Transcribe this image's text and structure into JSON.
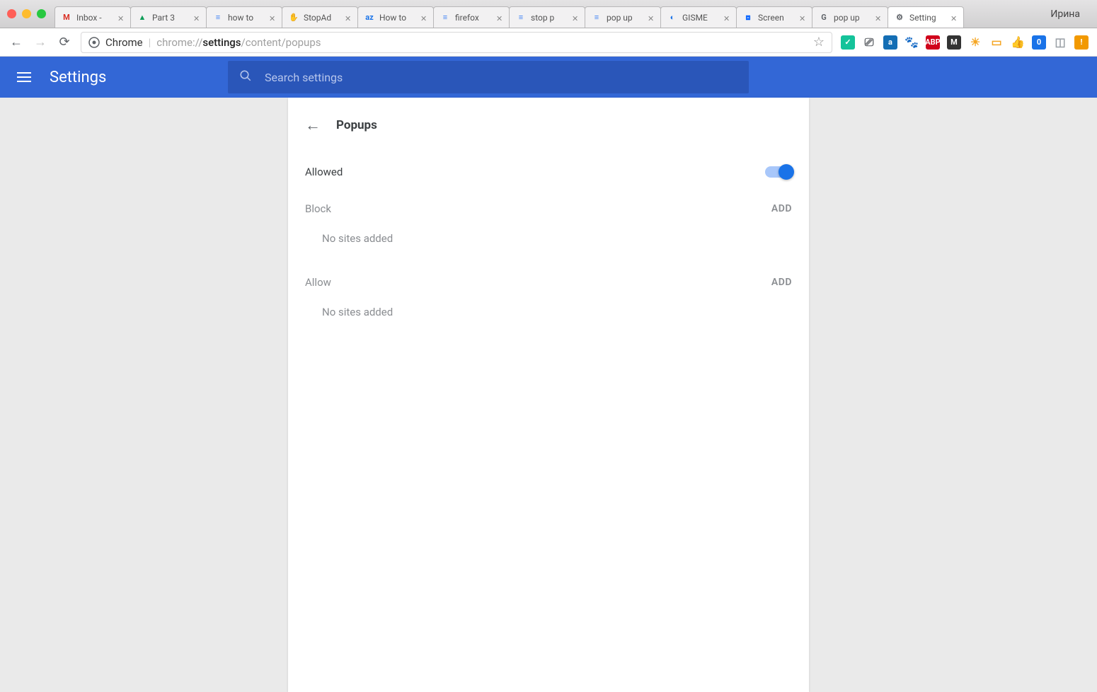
{
  "window": {
    "user": "Ирина"
  },
  "tabs": [
    {
      "label": "Inbox -",
      "favicon_text": "M",
      "favicon_color": "#d93025"
    },
    {
      "label": "Part 3",
      "favicon_text": "▲",
      "favicon_color": "#0f9d58"
    },
    {
      "label": "how to",
      "favicon_text": "≡",
      "favicon_color": "#4285f4"
    },
    {
      "label": "StopAd",
      "favicon_text": "✋",
      "favicon_color": "#e8710a"
    },
    {
      "label": "How to",
      "favicon_text": "az",
      "favicon_color": "#1a73e8"
    },
    {
      "label": "firefox",
      "favicon_text": "≡",
      "favicon_color": "#4285f4"
    },
    {
      "label": "stop p",
      "favicon_text": "≡",
      "favicon_color": "#4285f4"
    },
    {
      "label": "pop up",
      "favicon_text": "≡",
      "favicon_color": "#4285f4"
    },
    {
      "label": "GISME",
      "favicon_text": "◐",
      "favicon_color": "#1a73e8"
    },
    {
      "label": "Screen",
      "favicon_text": "⧈",
      "favicon_color": "#0061ff"
    },
    {
      "label": "pop up",
      "favicon_text": "G",
      "favicon_color": "#5f6368"
    },
    {
      "label": "Setting",
      "favicon_text": "⚙",
      "favicon_color": "#5f6368",
      "active": true
    }
  ],
  "toolbar": {
    "origin_label": "Chrome",
    "url_prefix": "chrome://",
    "url_strong": "settings",
    "url_suffix": "/content/popups"
  },
  "extensions": [
    {
      "name": "grammarly-icon",
      "bg": "#15c39a",
      "text": "✓"
    },
    {
      "name": "cast-icon",
      "bg": "transparent",
      "text": "⎚",
      "fg": "#5f6368"
    },
    {
      "name": "amazon-icon",
      "bg": "#146eb4",
      "text": "a"
    },
    {
      "name": "paw-icon",
      "bg": "transparent",
      "text": "🐾",
      "fg": "#b58863"
    },
    {
      "name": "abp-icon",
      "bg": "#d0021b",
      "text": "ABP"
    },
    {
      "name": "rd-icon",
      "bg": "#333",
      "text": "M"
    },
    {
      "name": "sun-icon",
      "bg": "transparent",
      "text": "☀",
      "fg": "#f5a623"
    },
    {
      "name": "rec-icon",
      "bg": "transparent",
      "text": "▭",
      "fg": "#f5a623"
    },
    {
      "name": "thumb-icon",
      "bg": "transparent",
      "text": "👍",
      "fg": "#5f6368"
    },
    {
      "name": "tag-icon",
      "bg": "#1a73e8",
      "text": "0"
    },
    {
      "name": "archive-icon",
      "bg": "transparent",
      "text": "◫",
      "fg": "#9aa0a6"
    },
    {
      "name": "warn-icon",
      "bg": "#f29900",
      "text": "!"
    }
  ],
  "header": {
    "title": "Settings",
    "search_placeholder": "Search settings"
  },
  "page": {
    "title": "Popups",
    "toggle_label": "Allowed",
    "toggle_on": true,
    "sections": [
      {
        "label": "Block",
        "add": "ADD",
        "empty": "No sites added"
      },
      {
        "label": "Allow",
        "add": "ADD",
        "empty": "No sites added"
      }
    ]
  }
}
